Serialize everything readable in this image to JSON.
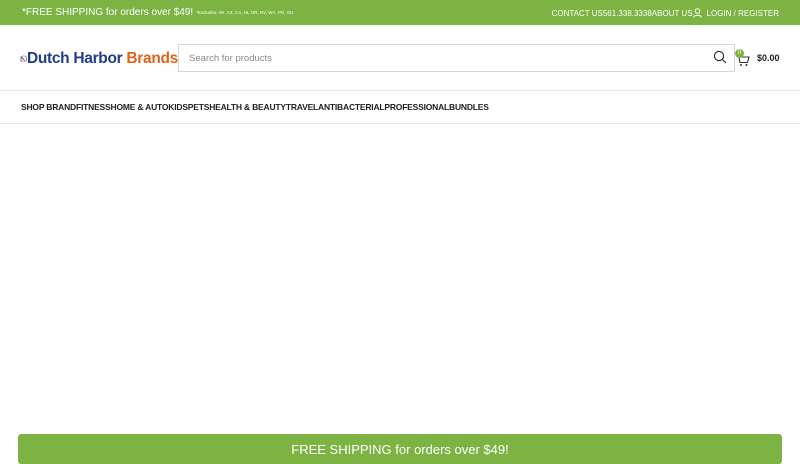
{
  "topbar": {
    "promo_main": "*FREE SHIPPING for orders over $49!",
    "promo_fine": "*Excludes: AK, AZ, CA, HI, OR, NV, WA, PR, GU",
    "contact": "CONTACT US",
    "phone": "561.338.3338",
    "about": "ABOUT US",
    "login": "LOGIN / REGISTER"
  },
  "logo": {
    "part1": "Dutch Harbor",
    "part2": "Brands"
  },
  "search": {
    "placeholder": "Search for products"
  },
  "cart": {
    "count": "0",
    "total": "$0.00"
  },
  "nav": {
    "items": [
      "SHOP BRAND",
      "FITNESS",
      "HOME & AUTO",
      "KIDS",
      "PETS",
      "HEALTH & BEAUTY",
      "TRAVEL",
      "ANTIBACTERIAL",
      "PROFESSIONAL",
      "BUNDLES"
    ]
  },
  "footer_bar": {
    "text": "FREE SHIPPING for orders over $49!"
  },
  "colors": {
    "accent_green": "#7cb342",
    "brand_blue": "#1f3c8c",
    "brand_orange": "#e1631a"
  },
  "icons": [
    "user-icon",
    "cart-icon",
    "search-icon"
  ]
}
